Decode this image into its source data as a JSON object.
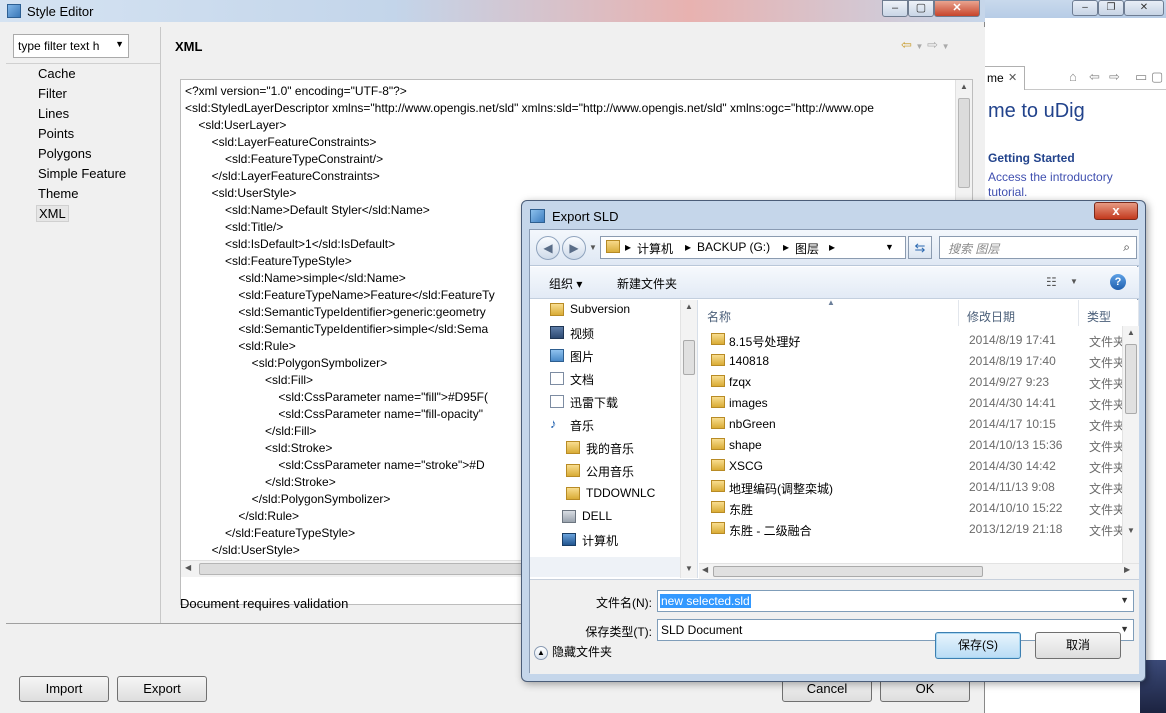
{
  "background_window": {
    "tab_label": "me",
    "welcome_text": "me to uDig",
    "getting_started": "Getting Started",
    "getting_started_desc_1": "Access the introductory",
    "getting_started_desc_2": "tutorial."
  },
  "style_editor": {
    "title": "Style Editor",
    "filter_text": "type filter text h",
    "nav_items": [
      "Cache",
      "Filter",
      "Lines",
      "Points",
      "Polygons",
      "Simple Feature",
      "Theme",
      "XML"
    ],
    "selected_nav": "XML",
    "page_title": "XML",
    "code_lines": [
      "<?xml version=\"1.0\" encoding=\"UTF-8\"?>",
      "<sld:StyledLayerDescriptor xmlns=\"http://www.opengis.net/sld\" xmlns:sld=\"http://www.opengis.net/sld\" xmlns:ogc=\"http://www.ope",
      "    <sld:UserLayer>",
      "        <sld:LayerFeatureConstraints>",
      "            <sld:FeatureTypeConstraint/>",
      "        </sld:LayerFeatureConstraints>",
      "        <sld:UserStyle>",
      "            <sld:Name>Default Styler</sld:Name>",
      "            <sld:Title/>",
      "            <sld:IsDefault>1</sld:IsDefault>",
      "            <sld:FeatureTypeStyle>",
      "                <sld:Name>simple</sld:Name>",
      "                <sld:FeatureTypeName>Feature</sld:FeatureTy",
      "                <sld:SemanticTypeIdentifier>generic:geometry",
      "                <sld:SemanticTypeIdentifier>simple</sld:Sema",
      "                <sld:Rule>",
      "                    <sld:PolygonSymbolizer>",
      "                        <sld:Fill>",
      "                            <sld:CssParameter name=\"fill\">#D95F(",
      "                            <sld:CssParameter name=\"fill-opacity\"",
      "                        </sld:Fill>",
      "                        <sld:Stroke>",
      "                            <sld:CssParameter name=\"stroke\">#D",
      "                        </sld:Stroke>",
      "                    </sld:PolygonSymbolizer>",
      "                </sld:Rule>",
      "            </sld:FeatureTypeStyle>",
      "        </sld:UserStyle>"
    ],
    "status": "Document requires validation",
    "import_label": "Import",
    "export_label": "Export",
    "cancel_label": "Cancel",
    "ok_label": "OK"
  },
  "export_dialog": {
    "title": "Export SLD",
    "close_label": "x",
    "breadcrumb": [
      "计算机",
      "BACKUP (G:)",
      "图层"
    ],
    "search_placeholder": "搜索 图层",
    "organize_label": "组织 ▾",
    "new_folder_label": "新建文件夹",
    "tree_items": [
      {
        "label": "Subversion",
        "icon": "folder-icon"
      },
      {
        "label": "视频",
        "icon": "video-library-icon"
      },
      {
        "label": "图片",
        "icon": "picture-library-icon"
      },
      {
        "label": "文档",
        "icon": "document-library-icon"
      },
      {
        "label": "迅雷下载",
        "icon": "document-library-icon"
      },
      {
        "label": "音乐",
        "icon": "music-library-icon"
      },
      {
        "label": "我的音乐",
        "icon": "folder-icon"
      },
      {
        "label": "公用音乐",
        "icon": "folder-icon"
      },
      {
        "label": "TDDOWNLC",
        "icon": "folder-icon"
      },
      {
        "label": "DELL",
        "icon": "drive-icon"
      },
      {
        "label": "计算机",
        "icon": "computer-icon"
      }
    ],
    "columns": [
      "名称",
      "修改日期",
      "类型"
    ],
    "files": [
      {
        "name": "8.15号处理好",
        "date": "2014/8/19 17:41",
        "type": "文件夹"
      },
      {
        "name": "140818",
        "date": "2014/8/19 17:40",
        "type": "文件夹"
      },
      {
        "name": "fzqx",
        "date": "2014/9/27 9:23",
        "type": "文件夹"
      },
      {
        "name": "images",
        "date": "2014/4/30 14:41",
        "type": "文件夹"
      },
      {
        "name": "nbGreen",
        "date": "2014/4/17 10:15",
        "type": "文件夹"
      },
      {
        "name": "shape",
        "date": "2014/10/13 15:36",
        "type": "文件夹"
      },
      {
        "name": "XSCG",
        "date": "2014/4/30 14:42",
        "type": "文件夹"
      },
      {
        "name": "地理编码(调整栾城)",
        "date": "2014/11/13 9:08",
        "type": "文件夹"
      },
      {
        "name": "东胜",
        "date": "2014/10/10 15:22",
        "type": "文件夹"
      },
      {
        "name": "东胜 - 二级融合",
        "date": "2013/12/19 21:18",
        "type": "文件夹"
      }
    ],
    "filename_label": "文件名(N):",
    "filename_value": "new selected.sld",
    "filetype_label": "保存类型(T):",
    "filetype_value": "SLD Document",
    "hide_folders_label": "隐藏文件夹",
    "save_label": "保存(S)",
    "cancel_label": "取消"
  }
}
